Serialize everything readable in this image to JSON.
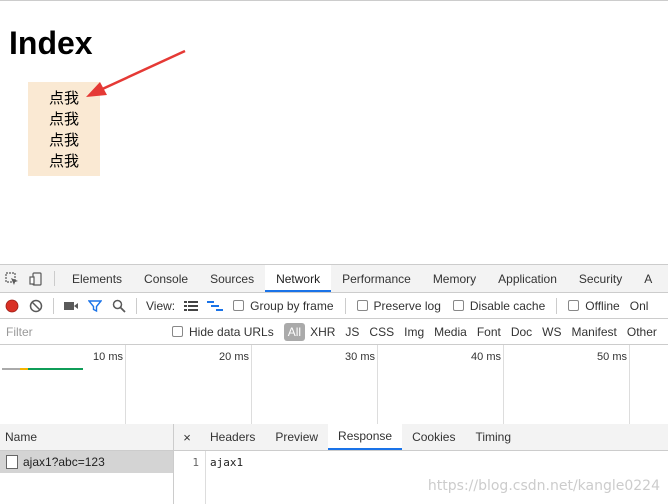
{
  "page": {
    "heading": "Index",
    "items": [
      "点我",
      "点我",
      "点我",
      "点我"
    ]
  },
  "devtools": {
    "tabs": [
      "Elements",
      "Console",
      "Sources",
      "Network",
      "Performance",
      "Memory",
      "Application",
      "Security",
      "A"
    ],
    "active_tab": "Network",
    "toolbar": {
      "view_label": "View:",
      "group_by_frame": "Group by frame",
      "preserve_log": "Preserve log",
      "disable_cache": "Disable cache",
      "offline": "Offline",
      "online": "Onl"
    },
    "filter": {
      "placeholder": "Filter",
      "hide_data_urls": "Hide data URLs",
      "types": [
        "All",
        "XHR",
        "JS",
        "CSS",
        "Img",
        "Media",
        "Font",
        "Doc",
        "WS",
        "Manifest",
        "Other"
      ]
    },
    "timeline": {
      "ticks": [
        "10 ms",
        "20 ms",
        "30 ms",
        "40 ms",
        "50 ms"
      ]
    },
    "requests": {
      "header": "Name",
      "rows": [
        "ajax1?abc=123"
      ]
    },
    "detail": {
      "close": "×",
      "tabs": [
        "Headers",
        "Preview",
        "Response",
        "Cookies",
        "Timing"
      ],
      "active_tab": "Response",
      "line_number": "1",
      "response_text": "ajax1"
    }
  },
  "colors": {
    "box_bg": "#fae9d3",
    "accent": "#1a73e8",
    "record": "#d93025",
    "arrow": "#e53935"
  },
  "watermark": "https://blog.csdn.net/kangle0224"
}
